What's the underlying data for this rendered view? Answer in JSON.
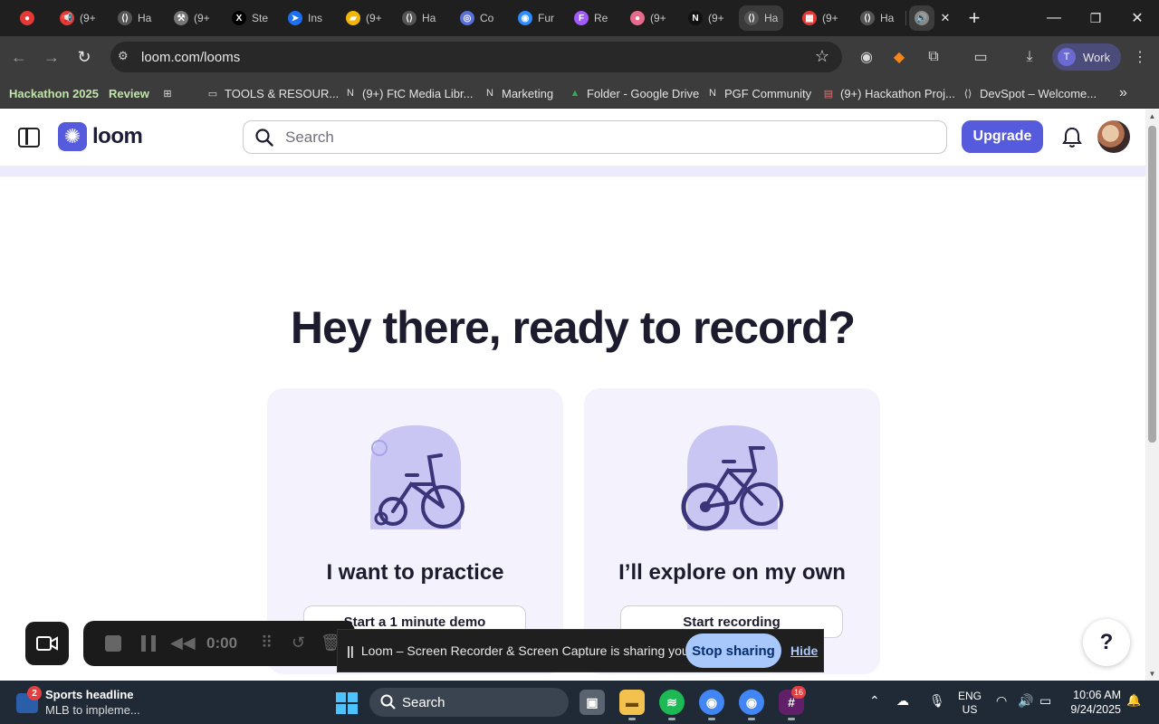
{
  "browser": {
    "tabs": [
      {
        "label": "",
        "icon": "record-icon",
        "color": "#e53935"
      },
      {
        "label": "(9+",
        "icon": "megaphone-icon",
        "color": "#e53935"
      },
      {
        "label": "Ha",
        "icon": "devpost-icon",
        "color": "#555"
      },
      {
        "label": "(9+",
        "icon": "tools-icon",
        "color": "#777"
      },
      {
        "label": "Ste",
        "icon": "x-icon",
        "color": "#000"
      },
      {
        "label": "Ins",
        "icon": "compass-icon",
        "color": "#1e6ef0"
      },
      {
        "label": "(9+",
        "icon": "folder-icon",
        "color": "#f2b705"
      },
      {
        "label": "Ha",
        "icon": "devpost-icon",
        "color": "#555"
      },
      {
        "label": "Co",
        "icon": "copilot-icon",
        "color": "#5b6fd8"
      },
      {
        "label": "Fur",
        "icon": "zoom-icon",
        "color": "#2d8cff"
      },
      {
        "label": "Re",
        "icon": "figma-icon",
        "color": "#a259ff"
      },
      {
        "label": "(9+",
        "icon": "brain-icon",
        "color": "#e86a8a"
      },
      {
        "label": "(9+",
        "icon": "notion-icon",
        "color": "#111"
      },
      {
        "label": "Ha",
        "icon": "devpost-icon",
        "color": "#555"
      },
      {
        "label": "(9+",
        "icon": "calendar-icon",
        "color": "#e53935"
      },
      {
        "label": "Ha",
        "icon": "devpost-icon",
        "color": "#555"
      },
      {
        "label": "",
        "icon": "speaker-icon",
        "color": "#888"
      }
    ],
    "new_tab": "+",
    "url": "loom.com/looms",
    "profile_initial": "T",
    "profile_label": "Work",
    "bookmarks": [
      {
        "label": "Hackathon 2025",
        "icon": ""
      },
      {
        "label": "Review",
        "icon": ""
      },
      {
        "label": "",
        "icon": "apps-grid-icon"
      },
      {
        "label": "TOOLS & RESOUR...",
        "icon": "folder-icon"
      },
      {
        "label": "(9+) FtC Media Libr...",
        "icon": "notion-icon"
      },
      {
        "label": "Marketing",
        "icon": "notion-icon"
      },
      {
        "label": "Folder - Google Drive",
        "icon": "drive-icon"
      },
      {
        "label": "PGF Community",
        "icon": "notion-icon"
      },
      {
        "label": "(9+) Hackathon Proj...",
        "icon": "doc-icon"
      },
      {
        "label": "DevSpot – Welcome...",
        "icon": "devpost-icon"
      }
    ]
  },
  "loom": {
    "brand": "loom",
    "search_placeholder": "Search",
    "upgrade_label": "Upgrade",
    "hero_title": "Hey there, ready to record?",
    "cards": [
      {
        "title": "I want to practice",
        "button": "Start a 1 minute demo"
      },
      {
        "title": "I’ll explore on my own",
        "button": "Start recording"
      }
    ],
    "help_label": "?",
    "accent_color": "#565add"
  },
  "recorder": {
    "timer": "0:00"
  },
  "share_bar": {
    "message": "Loom – Screen Recorder & Screen Capture is sharing your screen.",
    "stop_label": "Stop sharing",
    "hide_label": "Hide"
  },
  "taskbar": {
    "news_badge": "2",
    "news_title": "Sports headline",
    "news_subtitle": "MLB to impleme...",
    "search_label": "Search",
    "chrome_badge": "16",
    "lang_line1": "ENG",
    "lang_line2": "US",
    "time": "10:06 AM",
    "date": "9/24/2025"
  }
}
